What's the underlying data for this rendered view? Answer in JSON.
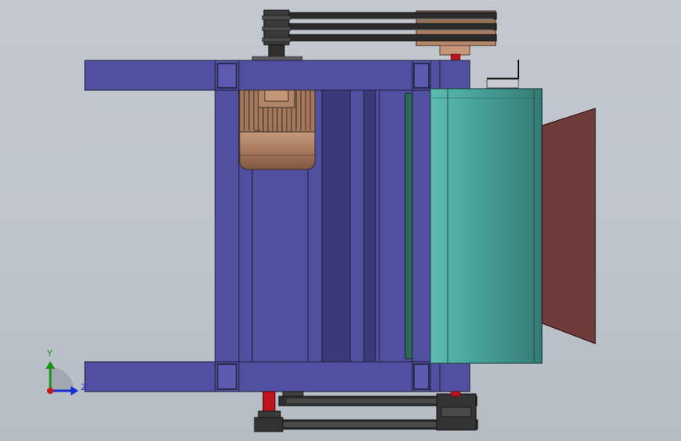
{
  "viewport": {
    "background": "#c1c6cd"
  },
  "triad": {
    "y_label": "Y",
    "z_label": "Z",
    "colors": {
      "y_axis": "#1b8f1b",
      "z_axis": "#1a2ed6",
      "x_axis": "#c81414"
    }
  },
  "model_colors": {
    "frame": "#5150a0",
    "frame_dark": "#3b3a79",
    "motor": "#a4785c",
    "drum": "#3f9088",
    "chute": "#6e3a3a",
    "belt": "#2e2e2e",
    "pulley": "#333333",
    "red_shaft": "#c0141c",
    "panel_green": "#2c6a55"
  }
}
